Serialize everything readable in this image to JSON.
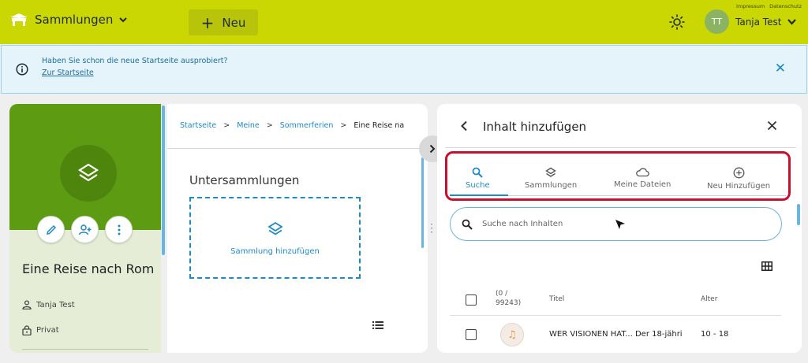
{
  "topbar": {
    "brand_label": "Sammlungen",
    "new_label": "Neu",
    "links": [
      "Impressum",
      "Datenschutz"
    ],
    "user_initials": "TT",
    "user_name": "Tanja Test"
  },
  "banner": {
    "text": "Haben Sie schon die neue Startseite ausprobiert?",
    "link": "Zur Startseite"
  },
  "collection": {
    "title": "Eine Reise nach Rom",
    "owner": "Tanja Test",
    "visibility": "Privat"
  },
  "breadcrumb": [
    "Startseite",
    "Meine",
    "Sommerferien",
    "Eine Reise na"
  ],
  "subcollections": {
    "heading": "Untersammlungen",
    "add_label": "Sammlung hinzufügen"
  },
  "panel": {
    "title": "Inhalt hinzufügen",
    "tabs": [
      {
        "label": "Suche",
        "icon": "search-icon",
        "active": true
      },
      {
        "label": "Sammlungen",
        "icon": "layers-icon",
        "active": false
      },
      {
        "label": "Meine Dateien",
        "icon": "cloud-icon",
        "active": false
      },
      {
        "label": "Neu Hinzufügen",
        "icon": "add-circle-icon",
        "active": false
      }
    ],
    "search_placeholder": "Suche nach Inhalten",
    "table": {
      "count_label": "(0 /",
      "count_total": "99243)",
      "col_title": "Titel",
      "col_age": "Alter",
      "rows": [
        {
          "title": "WER VISIONEN HAT... Der 18-jähri",
          "age": "10 - 18",
          "icon": "music-icon"
        }
      ]
    }
  },
  "colors": {
    "topbar": "#cbd703",
    "accent": "#1e8bc3",
    "collection_green": "#5d9c12",
    "highlight_red": "#c8102e"
  }
}
